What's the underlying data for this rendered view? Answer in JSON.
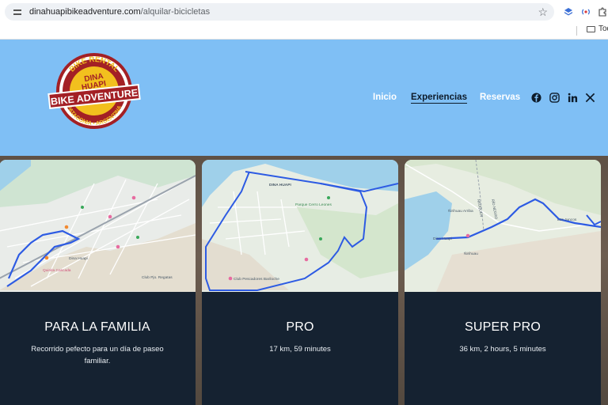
{
  "browser": {
    "url_domain": "dinahuapibikeadventure.com",
    "url_path": "/alquilar-bicicletas",
    "bookmark_label": "Tod"
  },
  "logo": {
    "line1": "BIKE RENTAL",
    "line2": "DINA",
    "line3": "HUAPI",
    "line4": "BIKE ADVENTURE",
    "line5": "PATAGONIA • ARGENTINA"
  },
  "nav": {
    "items": [
      {
        "label": "Inicio"
      },
      {
        "label": "Experiencias"
      },
      {
        "label": "Reservas"
      }
    ]
  },
  "social": [
    "facebook-icon",
    "instagram-icon",
    "linkedin-icon",
    "x-icon"
  ],
  "cards": [
    {
      "title": "PARA LA FAMILIA",
      "description": "Recorrido pefecto para un día de paseo familiar.",
      "map_labels": [
        "Dina Huapi",
        "Quinita Cascada",
        "Club Pjo. Regatas"
      ]
    },
    {
      "title": "PRO",
      "description": "17 km, 59 minutes",
      "map_labels": [
        "DINA HUAPI",
        "Parque Cerro Leones",
        "Club Pescadores Bariloche"
      ]
    },
    {
      "title": "SUPER PRO",
      "description": "36 km, 2 hours, 5 minutes",
      "map_labels": [
        "Ñirihuau Arriba",
        "NEUQUEN",
        "RÍO NEGRO",
        "Los Juncos",
        "Dina Huapi",
        "Ñirihuau"
      ]
    }
  ],
  "colors": {
    "header_bg": "#7fbff5",
    "card_bg": "#152231",
    "route_blue": "#2d5be3",
    "logo_red": "#a32025",
    "logo_yellow": "#f2c01e"
  }
}
